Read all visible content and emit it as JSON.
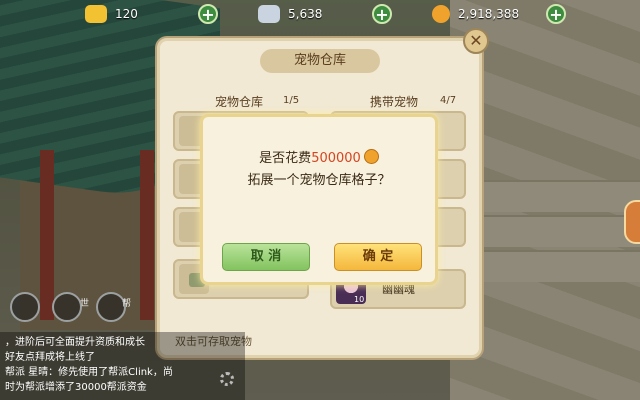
{
  "resources": [
    {
      "name": "gold-ingot",
      "value": "120",
      "color": "#f2c233"
    },
    {
      "name": "silver",
      "value": "5,638",
      "color": "#c9d4e0"
    },
    {
      "name": "coin",
      "value": "2,918,388",
      "color": "#f0a32c"
    }
  ],
  "plus_label": "+",
  "warehouse": {
    "title": "宠物仓库",
    "storage_label": "宠物仓库",
    "storage_count": "1/5",
    "carry_label": "携带宠物",
    "carry_count": "4/7",
    "pet_name": "幽幽魂",
    "pet_level": "10",
    "hint": "双击可存取宠物",
    "close_label": "✕"
  },
  "dialog": {
    "line1_prefix": "是否花费",
    "cost": "500000",
    "line2": "拓展一个宠物仓库格子？",
    "cancel": "取 消",
    "confirm": "确 定"
  },
  "voice": {
    "world": "世",
    "guild": "帮"
  },
  "chat": {
    "line1": "，进阶后可全面提升资质和成长",
    "line2": "好友点拜成将上线了",
    "line3": "帮派 星晴：修先使用了帮派Clink，尚",
    "line4": "时为帮派增添了30000帮派资金"
  }
}
